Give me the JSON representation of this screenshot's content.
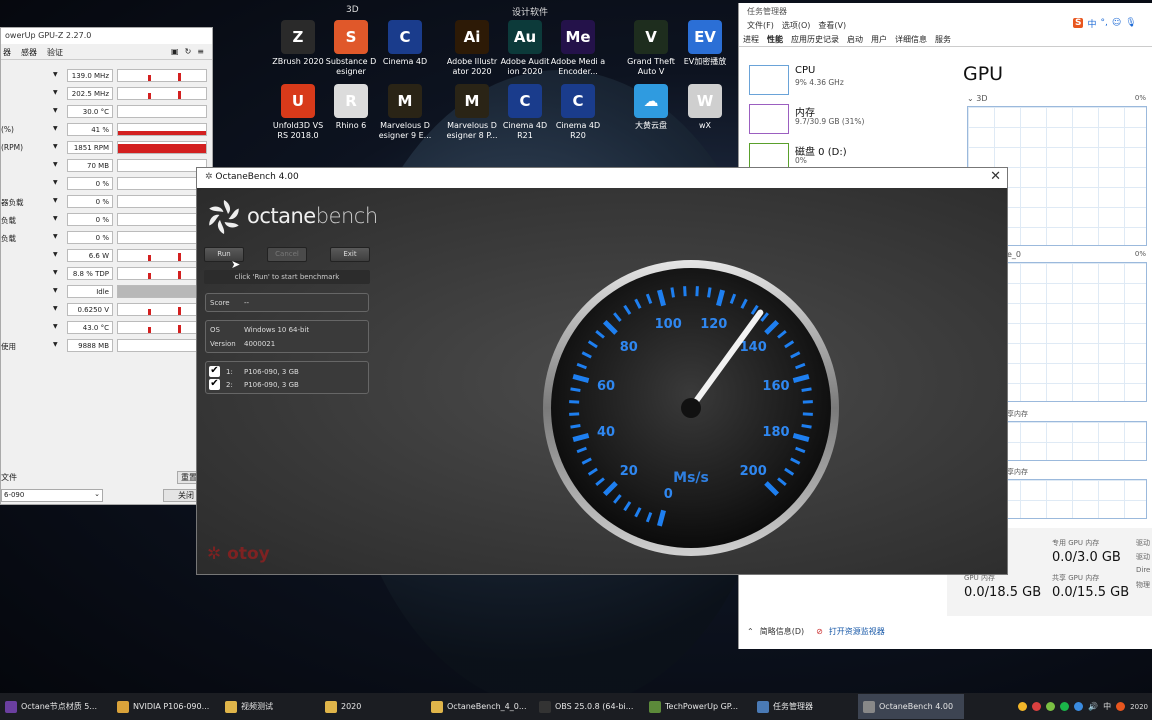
{
  "desktop": {
    "group_3d": "3D",
    "group_design": "设计软件",
    "icons": [
      {
        "label": "ZBrush 2020",
        "glyph": "Z",
        "color": "#2a2a2a"
      },
      {
        "label": "Substance D esigner",
        "glyph": "S",
        "color": "#e0582a"
      },
      {
        "label": "Cinema 4D",
        "glyph": "C",
        "color": "#1a3c8c"
      },
      {
        "label": "Adobe Illustr ator 2020",
        "glyph": "Ai",
        "color": "#2d1a06"
      },
      {
        "label": "Adobe Audit ion 2020",
        "glyph": "Au",
        "color": "#0c3a3a"
      },
      {
        "label": "Adobe Medi a Encoder...",
        "glyph": "Me",
        "color": "#24124a"
      },
      {
        "label": "Grand Theft Auto V",
        "glyph": "V",
        "color": "#1e2d1e"
      },
      {
        "label": "EV加密播放",
        "glyph": "EV",
        "color": "#2b6fd6"
      },
      {
        "label": "Unfold3D VS RS 2018.0",
        "glyph": "U",
        "color": "#d83a1a"
      },
      {
        "label": "Rhino 6",
        "glyph": "R",
        "color": "#dcdcdc"
      },
      {
        "label": "Marvelous D esigner 9 E...",
        "glyph": "M",
        "color": "#2a2416"
      },
      {
        "label": "Marvelous D esigner 8 P...",
        "glyph": "M",
        "color": "#2a2416"
      },
      {
        "label": "Cinema 4D R21",
        "glyph": "C",
        "color": "#1a3c8c"
      },
      {
        "label": "Cinema 4D R20",
        "glyph": "C",
        "color": "#1a3c8c"
      },
      {
        "label": "大黄云盘",
        "glyph": "☁",
        "color": "#2f9be0"
      },
      {
        "label": "wX",
        "glyph": "W",
        "color": "#cfcfcf"
      }
    ]
  },
  "gpuz": {
    "title": "owerUp GPU-Z 2.27.0",
    "tabs": [
      "器",
      "感器",
      "验证"
    ],
    "sensors": [
      {
        "label": "",
        "value": "139.0 MHz"
      },
      {
        "label": "",
        "value": "202.5 MHz"
      },
      {
        "label": "",
        "value": "30.0 °C"
      },
      {
        "label": "(%)",
        "value": "41 %",
        "level": 0.41
      },
      {
        "label": "(RPM)",
        "value": "1851 RPM",
        "level": 0.8
      },
      {
        "label": "",
        "value": "70 MB"
      },
      {
        "label": "",
        "value": "0 %"
      },
      {
        "label": "器负载",
        "value": "0 %"
      },
      {
        "label": "负载",
        "value": "0 %"
      },
      {
        "label": "负载",
        "value": "0 %"
      },
      {
        "label": "",
        "value": "6.6 W"
      },
      {
        "label": "",
        "value": "8.8 % TDP"
      },
      {
        "label": "",
        "value": "Idle",
        "gray": true
      },
      {
        "label": "",
        "value": "0.6250 V"
      },
      {
        "label": "",
        "value": "43.0 °C"
      },
      {
        "label": "使用",
        "value": "9888 MB"
      }
    ],
    "file_label": "文件",
    "reset_label": "重置",
    "device_select": "6-090",
    "close_label": "关闭"
  },
  "taskmgr": {
    "title": "任务管理器",
    "menu": [
      "文件(F)",
      "选项(O)",
      "查看(V)"
    ],
    "tabs": [
      "进程",
      "性能",
      "应用历史记录",
      "启动",
      "用户",
      "详细信息",
      "服务"
    ],
    "active_tab": "性能",
    "items": [
      {
        "name": "CPU",
        "sub": "9% 4.36 GHz"
      },
      {
        "name": "内存",
        "sub": "9.7/30.9 GB (31%)"
      },
      {
        "name": "磁盘 0 (D:)",
        "sub": "0%"
      }
    ],
    "gpu_heading": "GPU",
    "graph1_label": "3D",
    "graph1_pct": "0%",
    "graph2_label": "e_0",
    "graph2_pct": "0%",
    "share_label_1": "享内存",
    "share_label_2": "享内存",
    "dedicated_label": "专用 GPU 内存",
    "dedicated_value": "0.0/3.0 GB",
    "gpu_mem_label": "GPU 内存",
    "gpu_mem_value": "0.0/18.5 GB",
    "shared_label": "共享 GPU 内存",
    "shared_value": "0.0/15.5 GB",
    "side_labels": [
      "驱动",
      "驱动",
      "Dire",
      "物理"
    ],
    "brief_label": "简略信息(D)",
    "monitor_label": "打开资源监视器"
  },
  "ime": {
    "logo": "S",
    "lang": "中"
  },
  "octane": {
    "title": "OctaneBench 4.00",
    "logo_a": "octane",
    "logo_b": "bench",
    "run": "Run",
    "cancel": "Cancel",
    "exit": "Exit",
    "hint": "click 'Run' to start benchmark",
    "score_key": "Score",
    "score_val": "--",
    "os_key": "OS",
    "os_val": "Windows 10 64-bit",
    "version_key": "Version",
    "version_val": "4000021",
    "gpus": [
      {
        "idx": "1:",
        "name": "P106-090, 3 GB",
        "checked": true
      },
      {
        "idx": "2:",
        "name": "P106-090, 3 GB",
        "checked": true
      }
    ],
    "brand": "otoy"
  },
  "gauge": {
    "ticks": [
      0,
      20,
      40,
      60,
      80,
      100,
      120,
      140,
      160,
      180,
      200
    ],
    "unit": "Ms/s",
    "needle_value": 134,
    "min": 0,
    "max": 200
  },
  "taskbar": {
    "items": [
      {
        "label": "Octane节点材质 5...",
        "color": "#6b3fa0"
      },
      {
        "label": "NVIDIA P106-090...",
        "color": "#d9a23a"
      },
      {
        "label": "视频测试",
        "color": "#e0b54a"
      },
      {
        "label": "2020",
        "color": "#e0b54a"
      },
      {
        "label": "OctaneBench_4_0...",
        "color": "#e0b54a"
      },
      {
        "label": "OBS 25.0.8 (64-bi...",
        "color": "#333"
      },
      {
        "label": "TechPowerUp GP...",
        "color": "#5c8a3a"
      },
      {
        "label": "任务管理器",
        "color": "#4a7ab5"
      },
      {
        "label": "OctaneBench 4.00",
        "color": "#888",
        "active": true
      }
    ],
    "tray_ime": "中",
    "clock_date": "2020"
  }
}
